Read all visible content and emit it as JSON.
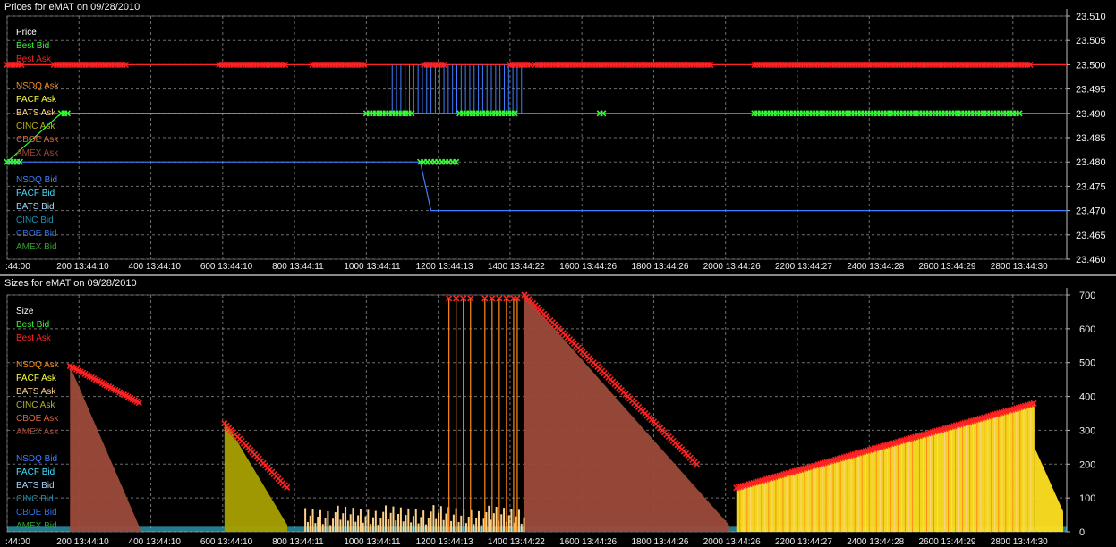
{
  "window": {
    "top_title": "Prices for  eMAT  on  09/28/2010",
    "bottom_title": "Sizes for  eMAT  on  09/28/2010"
  },
  "colors": {
    "background": "#000000",
    "grid": "#8a8a8a",
    "best_bid": "#33ff33",
    "best_ask": "#ff2222",
    "nsdq_ask": "#ff8c1a",
    "pacf_ask": "#ffff40",
    "bats_ask": "#ffd28a",
    "cinc_ask": "#b8b020",
    "cboe_ask": "#d86a40",
    "amex_ask": "#a04838",
    "nsdq_bid": "#3f7fff",
    "pacf_bid": "#40e0ff",
    "bats_bid": "#a6d8ff",
    "cinc_bid": "#1f90b0",
    "cboe_bid": "#2f6fe0",
    "amex_bid": "#33a033",
    "axis_text": "#f0f0f0"
  },
  "chart_data": [
    {
      "type": "line",
      "name": "prices",
      "ylabel": "Price",
      "ylim": [
        23.46,
        23.51
      ],
      "yticks": [
        "23.510",
        "23.505",
        "23.500",
        "23.495",
        "23.490",
        "23.485",
        "23.480",
        "23.475",
        "23.470",
        "23.465",
        "23.460"
      ],
      "xlim": [
        0,
        2950
      ],
      "xticks": [
        {
          "x": 0,
          "label": ":44:00"
        },
        {
          "x": 200,
          "label": "200 13:44:10"
        },
        {
          "x": 400,
          "label": "400 13:44:10"
        },
        {
          "x": 600,
          "label": "600 13:44:10"
        },
        {
          "x": 800,
          "label": "800 13:44:11"
        },
        {
          "x": 1000,
          "label": "1000 13:44:11"
        },
        {
          "x": 1200,
          "label": "1200 13:44:13"
        },
        {
          "x": 1400,
          "label": "1400 13:44:22"
        },
        {
          "x": 1600,
          "label": "1600 13:44:26"
        },
        {
          "x": 1800,
          "label": "1800 13:44:26"
        },
        {
          "x": 2000,
          "label": "2000 13:44:26"
        },
        {
          "x": 2200,
          "label": "2200 13:44:27"
        },
        {
          "x": 2400,
          "label": "2400 13:44:28"
        },
        {
          "x": 2600,
          "label": "2600 13:44:29"
        },
        {
          "x": 2800,
          "label": "2800 13:44:30"
        }
      ],
      "legend": [
        {
          "label": "Best Bid",
          "color": "#33ff33"
        },
        {
          "label": "Best Ask",
          "color": "#ff2222"
        },
        {
          "label": "NSDQ Ask",
          "color": "#ff8c1a"
        },
        {
          "label": "PACF Ask",
          "color": "#ffff40"
        },
        {
          "label": "BATS Ask",
          "color": "#ffd28a"
        },
        {
          "label": "CINC Ask",
          "color": "#b8b020"
        },
        {
          "label": "CBOE Ask",
          "color": "#d86a40"
        },
        {
          "label": "AMEX Ask",
          "color": "#a04838"
        },
        {
          "label": "NSDQ Bid",
          "color": "#3f7fff"
        },
        {
          "label": "PACF Bid",
          "color": "#40e0ff"
        },
        {
          "label": "BATS Bid",
          "color": "#a6d8ff"
        },
        {
          "label": "CINC Bid",
          "color": "#1f90b0"
        },
        {
          "label": "CBOE Bid",
          "color": "#2f6fe0"
        },
        {
          "label": "AMEX Bid",
          "color": "#33a033"
        }
      ],
      "series": [
        {
          "name": "Best Ask",
          "color": "#ff2222",
          "points": [
            [
              0,
              23.5
            ],
            [
              2950,
              23.5
            ]
          ]
        },
        {
          "name": "Best Bid",
          "color": "#33ff33",
          "points": [
            [
              0,
              23.48
            ],
            [
              150,
              23.49
            ],
            [
              2950,
              23.49
            ]
          ]
        },
        {
          "name": "NSDQ Bid",
          "color": "#3f7fff",
          "points": [
            [
              0,
              23.48
            ],
            [
              1150,
              23.48
            ],
            [
              1180,
              23.47
            ],
            [
              2950,
              23.47
            ]
          ]
        },
        {
          "name": "BATS Bid",
          "color": "#3f7fff",
          "points": [
            [
              1150,
              23.49
            ],
            [
              2950,
              23.49
            ]
          ]
        }
      ],
      "ask_marker_runs": [
        [
          0,
          40
        ],
        [
          130,
          330
        ],
        [
          590,
          780
        ],
        [
          850,
          1000
        ],
        [
          1160,
          1220
        ],
        [
          1400,
          1460
        ],
        [
          1470,
          1960
        ],
        [
          2080,
          2850
        ]
      ],
      "bid_marker_runs": [
        [
          0,
          40
        ],
        [
          150,
          170
        ],
        [
          1000,
          1130
        ],
        [
          1260,
          1420
        ],
        [
          1650,
          1660
        ],
        [
          2080,
          2820
        ]
      ],
      "low_bid_marker_runs": [
        [
          1150,
          1250
        ]
      ]
    },
    {
      "type": "area",
      "name": "sizes",
      "ylabel": "Size",
      "ylim": [
        0,
        700
      ],
      "yticks": [
        "700",
        "600",
        "500",
        "400",
        "300",
        "200",
        "100",
        "0"
      ],
      "xlim": [
        0,
        2950
      ],
      "xticks": [
        {
          "x": 0,
          "label": ":44:00"
        },
        {
          "x": 200,
          "label": "200 13:44:10"
        },
        {
          "x": 400,
          "label": "400 13:44:10"
        },
        {
          "x": 600,
          "label": "600 13:44:10"
        },
        {
          "x": 800,
          "label": "800 13:44:11"
        },
        {
          "x": 1000,
          "label": "1000 13:44:11"
        },
        {
          "x": 1200,
          "label": "1200 13:44:13"
        },
        {
          "x": 1400,
          "label": "1400 13:44:22"
        },
        {
          "x": 1600,
          "label": "1600 13:44:26"
        },
        {
          "x": 1800,
          "label": "1800 13:44:26"
        },
        {
          "x": 2000,
          "label": "2000 13:44:26"
        },
        {
          "x": 2200,
          "label": "2200 13:44:27"
        },
        {
          "x": 2400,
          "label": "2400 13:44:28"
        },
        {
          "x": 2600,
          "label": "2600 13:44:29"
        },
        {
          "x": 2800,
          "label": "2800 13:44:30"
        }
      ],
      "legend": [
        {
          "label": "Best Bid",
          "color": "#33ff33"
        },
        {
          "label": "Best Ask",
          "color": "#ff2222"
        },
        {
          "label": "NSDQ Ask",
          "color": "#ff8c1a"
        },
        {
          "label": "PACF Ask",
          "color": "#ffff40"
        },
        {
          "label": "BATS Ask",
          "color": "#ffd28a"
        },
        {
          "label": "CINC Ask",
          "color": "#b8b020"
        },
        {
          "label": "CBOE Ask",
          "color": "#d86a40"
        },
        {
          "label": "AMEX Ask",
          "color": "#a04838"
        },
        {
          "label": "NSDQ Bid",
          "color": "#3f7fff"
        },
        {
          "label": "PACF Bid",
          "color": "#40e0ff"
        },
        {
          "label": "BATS Bid",
          "color": "#a6d8ff"
        },
        {
          "label": "CINC Bid",
          "color": "#1f90b0"
        },
        {
          "label": "CBOE Bid",
          "color": "#2f6fe0"
        },
        {
          "label": "AMEX Bid",
          "color": "#33a033"
        }
      ],
      "areas": [
        {
          "name": "AMEX Ask",
          "color": "#9c4a3a",
          "points": [
            [
              175,
              490
            ],
            [
              370,
              10
            ]
          ]
        },
        {
          "name": "CINC Ask",
          "color": "#a8a000",
          "points": [
            [
              605,
              330
            ],
            [
              780,
              20
            ]
          ]
        },
        {
          "name": "AMEX Ask",
          "color": "#9c4a3a",
          "points": [
            [
              1440,
              700
            ],
            [
              2010,
              20
            ]
          ]
        },
        {
          "name": "PACF Ask",
          "color": "#ffe020",
          "points": [
            [
              2030,
              130
            ],
            [
              2860,
              380
            ]
          ]
        },
        {
          "name": "PACF Ask",
          "color": "#ffe020",
          "points": [
            [
              2860,
              250
            ],
            [
              2940,
              60
            ]
          ]
        }
      ],
      "ask_marker_segments": [
        [
          [
            175,
            490
          ],
          [
            370,
            380
          ]
        ],
        [
          [
            605,
            320
          ],
          [
            780,
            130
          ]
        ],
        [
          [
            1440,
            700
          ],
          [
            1920,
            200
          ]
        ],
        [
          [
            2030,
            130
          ],
          [
            2860,
            380
          ]
        ]
      ],
      "tall_spikes": [
        1230,
        1250,
        1270,
        1290,
        1330,
        1350,
        1370,
        1390,
        1410,
        1420
      ]
    }
  ]
}
